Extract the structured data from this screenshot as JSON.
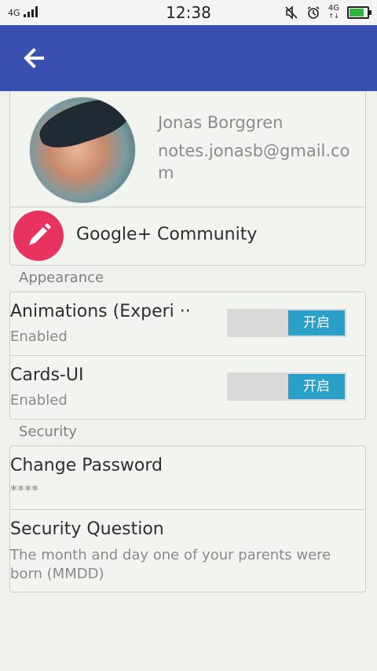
{
  "status_bar": {
    "network_left": "4G",
    "time": "12:38",
    "network_right": "4G",
    "network_right_arrows": "↑↓"
  },
  "profile": {
    "name": "Jonas Borggren",
    "email": "notes.jonasb@gmail.com"
  },
  "community": {
    "label": "Google+ Community"
  },
  "sections": {
    "appearance": {
      "header": "Appearance",
      "items": [
        {
          "title": "Animations (Experi ··",
          "subtitle": "Enabled",
          "toggle_label": "开启"
        },
        {
          "title": "Cards-UI",
          "subtitle": "Enabled",
          "toggle_label": "开启"
        }
      ]
    },
    "security": {
      "header": "Security",
      "items": [
        {
          "title": "Change Password",
          "subtitle": "****"
        },
        {
          "title": "Security Question",
          "subtitle": "The month and day one of your parents were born (MMDD)"
        }
      ]
    }
  },
  "colors": {
    "app_bar": "#3a50b0",
    "background": "#eff1ed",
    "toggle_on": "#2a9fc7",
    "community_icon": "#e9335f"
  },
  "icons": {
    "back": "arrow-left-icon",
    "mute": "mute-icon",
    "alarm": "alarm-icon",
    "battery": "battery-icon",
    "signal": "signal-icon",
    "edit": "pencil-icon"
  }
}
